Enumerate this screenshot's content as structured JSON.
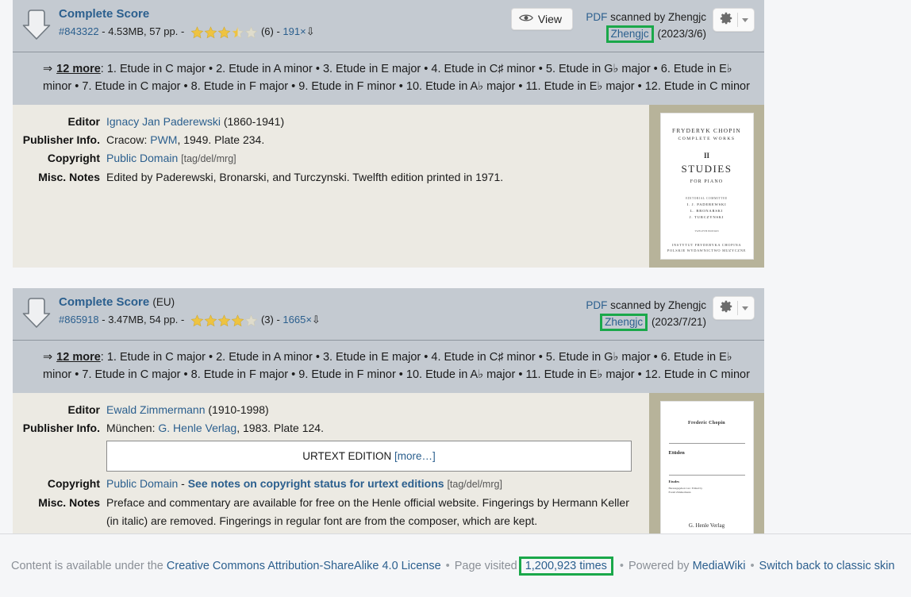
{
  "scores": [
    {
      "title": "Complete Score",
      "title_suffix": "",
      "file_id": "#843322",
      "file_size": "4.53MB",
      "pages": "57 pp.",
      "rating_value": 3.5,
      "rating_count": "(6)",
      "downloads": "191×",
      "view_label": "View",
      "format_link": "PDF",
      "scanned_by_text": "scanned by Zhengjc",
      "uploader": "Zhengjc",
      "upload_date": "(2023/3/6)",
      "uploader_highlighted": true,
      "more_arrow": "⇒",
      "more_link": "12 more",
      "more_colon": ":",
      "movements": "1. Etude in C major • 2. Etude in A minor • 3. Etude in E major • 4. Etude in C♯ minor • 5. Etude in G♭ major • 6. Etude in E♭ minor • 7. Etude in C major • 8. Etude in F major • 9. Etude in F minor • 10. Etude in A♭ major • 11. Etude in E♭ major • 12. Etude in C minor",
      "meta": [
        {
          "label": "Editor",
          "link": "Ignacy Jan Paderewski",
          "after": " (1860-1941)"
        },
        {
          "label": "Publisher Info.",
          "pre": "Cracow: ",
          "link": "PWM",
          "after": ", 1949. Plate 234."
        },
        {
          "label": "Copyright",
          "link": "Public Domain",
          "tags": "[tag/del/mrg]"
        },
        {
          "label": "Misc. Notes",
          "text": "Edited by Paderewski, Bronarski, and Turczynski. Twelfth edition printed in 1971."
        }
      ],
      "thumbnail": {
        "line1": "FRYDERYK CHOPIN",
        "line2": "COMPLETE WORKS",
        "line3": "II",
        "line4": "STUDIES",
        "line5": "FOR PIANO",
        "line6": "EDITORIAL COMMITTEE",
        "line7": "I. J. PADEREWSKI",
        "line7b": "L. BRONARSKI",
        "line7c": "J. TURCZYNSKI",
        "line8": "TWELFTH EDITION",
        "line9": "INSTYTUT FRYDERYKA CHOPINA",
        "line10": "POLSKIE WYDAWNICTWO MUZYCZNE"
      }
    },
    {
      "title": "Complete Score",
      "title_suffix": "(EU)",
      "file_id": "#865918",
      "file_size": "3.47MB",
      "pages": "54 pp.",
      "rating_value": 4,
      "rating_count": "(3)",
      "downloads": "1665×",
      "view_label": "",
      "format_link": "PDF",
      "scanned_by_text": "scanned by Zhengjc",
      "uploader": "Zhengjc",
      "upload_date": "(2023/7/21)",
      "uploader_highlighted": true,
      "more_arrow": "⇒",
      "more_link": "12 more",
      "more_colon": ":",
      "movements": "1. Etude in C major • 2. Etude in A minor • 3. Etude in E major • 4. Etude in C♯ minor • 5. Etude in G♭ major • 6. Etude in E♭ minor • 7. Etude in C major • 8. Etude in F major • 9. Etude in F minor • 10. Etude in A♭ major • 11. Etude in E♭ major • 12. Etude in C minor",
      "urtext_label": "URTEXT EDITION",
      "urtext_more": "[more…]",
      "meta": [
        {
          "label": "Editor",
          "link": "Ewald Zimmermann",
          "after": " (1910-1998)"
        },
        {
          "label": "Publisher Info.",
          "pre": "München: ",
          "link": "G. Henle Verlag",
          "after": ", 1983. Plate 124."
        },
        {
          "label": "Copyright",
          "link": "Public Domain",
          "dash": " - ",
          "warn": "See notes on copyright status for urtext editions",
          "tags": "[tag/del/mrg]"
        },
        {
          "label": "Misc. Notes",
          "text": "Preface and commentary are available for free on the Henle official website. Fingerings by Hermann Keller (in italic) are removed. Fingerings in regular font are from the composer, which are kept."
        }
      ],
      "thumbnail": {
        "line1": "Frederic Chopin",
        "line2": "Etüden",
        "line3": "Etudes",
        "line4": "Herausgegeben von / Edited by",
        "line5": "Ewald Zimmermann",
        "line6": "G. Henle Verlag"
      }
    }
  ],
  "footer": {
    "license_prefix": "Content is available under the",
    "license_link": "Creative Commons Attribution-ShareAlike 4.0 License",
    "visits_prefix": "Page visited",
    "visits_count": "1,200,923 times",
    "powered_prefix": "Powered by",
    "powered_link": "MediaWiki",
    "switch_link": "Switch back to classic skin",
    "separator": "•"
  },
  "colors": {
    "accent_link": "#2b5f8e",
    "highlight_green": "#1aa84a",
    "header_bar": "#c4cad1",
    "body_bg": "#eceae3",
    "thumb_bg": "#b7b39a",
    "warn_red": "#e0160f"
  }
}
